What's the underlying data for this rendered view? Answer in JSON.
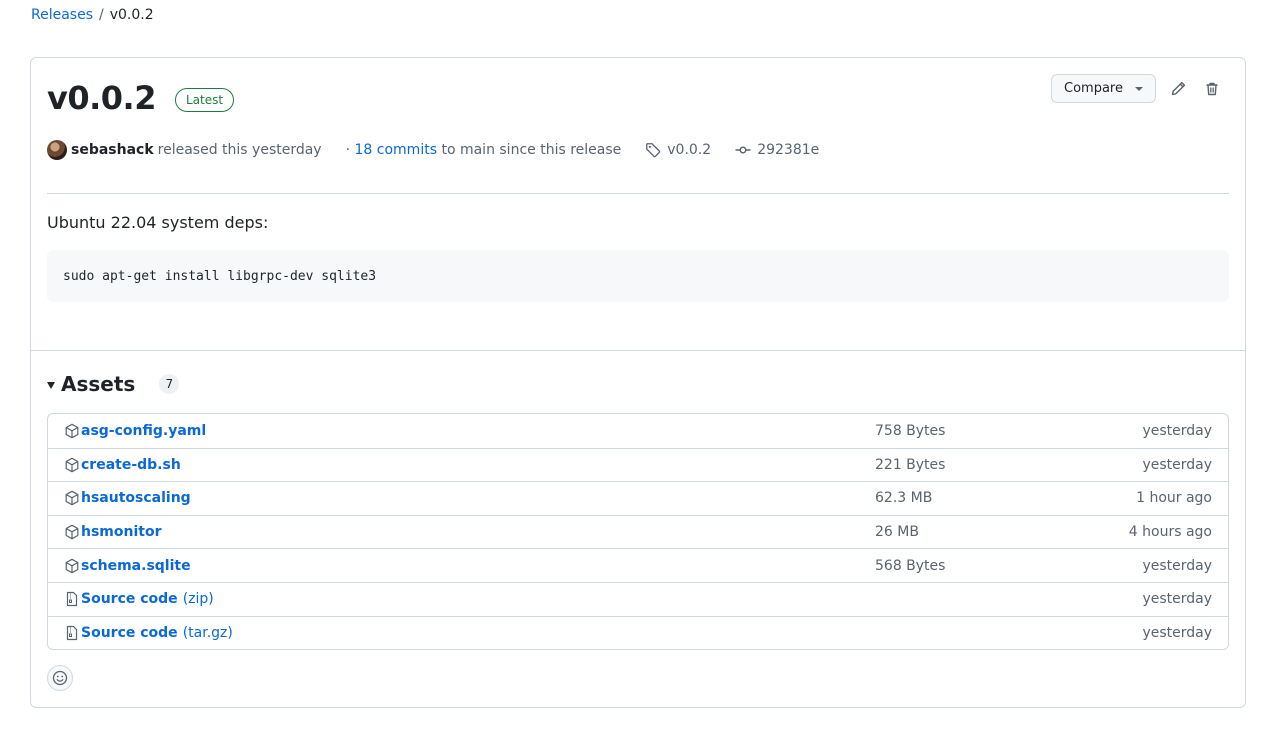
{
  "breadcrumb": {
    "root": "Releases",
    "separator": "/",
    "current": "v0.0.2"
  },
  "release": {
    "title": "v0.0.2",
    "badge": "Latest",
    "author": "sebashack",
    "released_text": "released this yesterday",
    "commits_prefix": "·",
    "commits_link": "18 commits",
    "commits_suffix": "to main since this release",
    "tag": "v0.0.2",
    "commit_sha": "292381e"
  },
  "actions": {
    "compare_label": "Compare"
  },
  "notes": {
    "heading": "Ubuntu 22.04 system deps:",
    "code": "sudo apt-get install libgrpc-dev sqlite3"
  },
  "assets": {
    "title": "Assets",
    "count": "7",
    "items": [
      {
        "name": "asg-config.yaml",
        "suffix": "",
        "size": "758 Bytes",
        "date": "yesterday",
        "icon": "package-icon"
      },
      {
        "name": "create-db.sh",
        "suffix": "",
        "size": "221 Bytes",
        "date": "yesterday",
        "icon": "package-icon"
      },
      {
        "name": "hsautoscaling",
        "suffix": "",
        "size": "62.3 MB",
        "date": "1 hour ago",
        "icon": "package-icon"
      },
      {
        "name": "hsmonitor",
        "suffix": "",
        "size": "26 MB",
        "date": "4 hours ago",
        "icon": "package-icon"
      },
      {
        "name": "schema.sqlite",
        "suffix": "",
        "size": "568 Bytes",
        "date": "yesterday",
        "icon": "package-icon"
      },
      {
        "name": "Source code",
        "suffix": "(zip)",
        "size": "",
        "date": "yesterday",
        "icon": "file-zip-icon"
      },
      {
        "name": "Source code",
        "suffix": "(tar.gz)",
        "size": "",
        "date": "yesterday",
        "icon": "file-zip-icon"
      }
    ]
  },
  "colors": {
    "link": "#0969da",
    "latest": "#1a7f37",
    "muted": "#59636e",
    "border": "#d1d9e0"
  }
}
